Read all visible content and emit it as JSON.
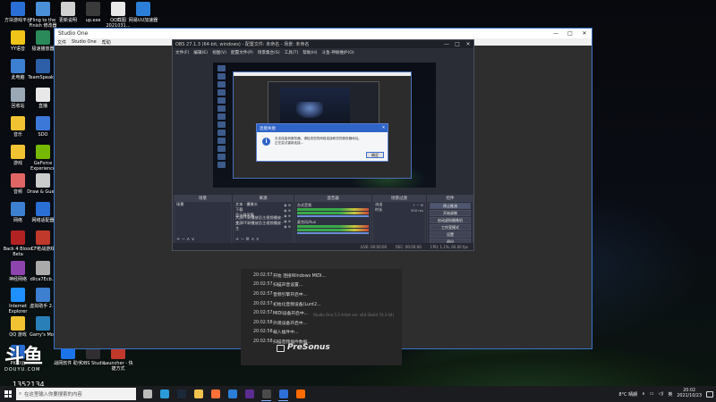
{
  "desktop": {
    "icons": [
      {
        "label": "方块游戏平台",
        "color": "#2a6fd6"
      },
      {
        "label": "Fling to the Finish 修改器",
        "color": "#4a90d9"
      },
      {
        "label": "更新说明",
        "color": "#d0d0d0"
      },
      {
        "label": "up.exe",
        "color": "#3a3a3a"
      },
      {
        "label": "QQ截图 2021031...",
        "color": "#e8e8e8"
      },
      {
        "label": "网易UU加速器",
        "color": "#2b7fd8"
      },
      {
        "label": "YY语音",
        "color": "#f0c419"
      },
      {
        "label": "极速播放器",
        "color": "#2a8a5a"
      },
      {
        "label": "此电脑",
        "color": "#3d7fd0"
      },
      {
        "label": "TeamSpeak 3",
        "color": "#2c5fa8"
      },
      {
        "label": "回收站",
        "color": "#9aa7b5"
      },
      {
        "label": "直播",
        "color": "#e8e8e8"
      },
      {
        "label": "音乐",
        "color": "#f1c232"
      },
      {
        "label": "SDO",
        "color": "#3c78d8"
      },
      {
        "label": "游戏",
        "color": "#f1c232"
      },
      {
        "label": "GeForce Experience",
        "color": "#76b900"
      },
      {
        "label": "音频",
        "color": "#e06666"
      },
      {
        "label": "Draw & Guess",
        "color": "#cccccc"
      },
      {
        "label": "网络",
        "color": "#3d7fd0"
      },
      {
        "label": "网络适配器",
        "color": "#2a6fd6"
      },
      {
        "label": "Back 4 Blood Beta",
        "color": "#b22222"
      },
      {
        "label": "CF枪战游戏",
        "color": "#c0392b"
      },
      {
        "label": "神经网络",
        "color": "#8e44ad"
      },
      {
        "label": "dllca7Ecb...",
        "color": "#aaaaaa"
      },
      {
        "label": "Internet Explorer",
        "color": "#1e90ff"
      },
      {
        "label": "虚拟助手 2.0",
        "color": "#3d7fd0"
      },
      {
        "label": "QQ 游戏",
        "color": "#f1c232"
      },
      {
        "label": "Garry's Mod",
        "color": "#2980b9"
      },
      {
        "label": "PICO云",
        "color": "#2a6fd6"
      },
      {
        "label": "战网软件 助手",
        "color": "#1a73e8"
      },
      {
        "label": "OBS Studio",
        "color": "#302e31"
      },
      {
        "label": "Launcher - 快捷方式",
        "color": "#c0392b"
      }
    ]
  },
  "studio_one": {
    "title": "Studio One",
    "menu": [
      "文件",
      "Studio One",
      "帮助"
    ],
    "window_controls": [
      "—",
      "□",
      "✕"
    ],
    "log": [
      {
        "time": "20:02:57",
        "text": "开始 连接Windows MIDI..."
      },
      {
        "time": "20:02:57",
        "text": "扫描声音设置..."
      },
      {
        "time": "20:02:57",
        "text": "音频引擎开启中..."
      },
      {
        "time": "20:02:57",
        "text": "初始化音频设备(Lunt2..."
      },
      {
        "time": "20:02:57",
        "text": "MIDI设备开启中..."
      },
      {
        "time": "20:02:58",
        "text": "外观设备开启中..."
      },
      {
        "time": "20:02:58",
        "text": "载入插件中..."
      },
      {
        "time": "20:02:58",
        "text": "扫描音频插件数据..."
      }
    ],
    "brand": "PreSonus",
    "version": "Studio One 5.5 Artist ver. x64 (Build 70.3 04)"
  },
  "obs": {
    "title": "OBS 27.1.3 (64-bit, windows) - 配置文件: 未命名 - 场景: 未命名",
    "window_controls": [
      "—",
      "□",
      "✕"
    ],
    "menu": [
      "文件(F)",
      "编辑(E)",
      "视图(V)",
      "配置文件(P)",
      "场景集合(S)",
      "工具(T)",
      "帮助(H)",
      "斗鱼·神秘维护(O)"
    ],
    "docks": {
      "scenes": {
        "title": "场景",
        "items": [
          "场景"
        ]
      },
      "sources": {
        "title": "来源",
        "items": [
          {
            "name": "文本 · 摄像头",
            "val": "◉ ⊕"
          },
          {
            "name": "下载",
            "val": "◉ ⊕"
          },
          {
            "name": "显示器采集",
            "val": "◉ ⊕"
          },
          {
            "name": "大屏FF刷播放员主视频播放 · 主",
            "val": "◉ ⊕"
          },
          {
            "name": "大屏FF刷播放员主视频播放 · 主",
            "val": "◉ ⊕"
          }
        ]
      },
      "mixer": {
        "title": "混音器",
        "tracks": [
          "台式音频",
          "麦克风/Aux"
        ]
      },
      "transitions": {
        "title": "场景过渡",
        "type": "淡出",
        "duration_label": "时长",
        "duration": "300 ms"
      },
      "controls": {
        "title": "控件",
        "buttons": [
          "停止推流",
          "开始录制",
          "启动虚拟摄像机",
          "工作室模式",
          "设置",
          "退出"
        ]
      }
    },
    "status": {
      "live": "LIVE: 00:00:00",
      "rec": "REC: 00:00:00",
      "cpu": "CPU: 1.1%, 60.00 fps"
    }
  },
  "dialog": {
    "title": "连接失败",
    "message": "无法连接到服务器。请检查您的网络连接和您的服务器地址。",
    "message2": "正在尝试重新连接...",
    "ok_label": "确定"
  },
  "overlay": {
    "logo_text": "斗鱼",
    "logo_sub": "DOUYU.COM",
    "room_number": "1352134"
  },
  "taskbar": {
    "search_placeholder": "在这里输入你要搜索的内容",
    "apps": [
      {
        "name": "task-view",
        "color": "#bbbbbb"
      },
      {
        "name": "edge",
        "color": "#2a9bd8"
      },
      {
        "name": "steam",
        "color": "#1b2838"
      },
      {
        "name": "file-explorer",
        "color": "#f2c14e"
      },
      {
        "name": "firefox",
        "color": "#ff7139"
      },
      {
        "name": "qq",
        "color": "#2b7fd8"
      },
      {
        "name": "visual-studio",
        "color": "#5c2d91"
      },
      {
        "name": "obs",
        "color": "#4a4a4a"
      },
      {
        "name": "studio-one",
        "color": "#2e6fd8"
      },
      {
        "name": "douyu",
        "color": "#ff6a00"
      }
    ],
    "weather": "8°C 晴朗",
    "time": "20:02",
    "date": "2021/10/23"
  }
}
